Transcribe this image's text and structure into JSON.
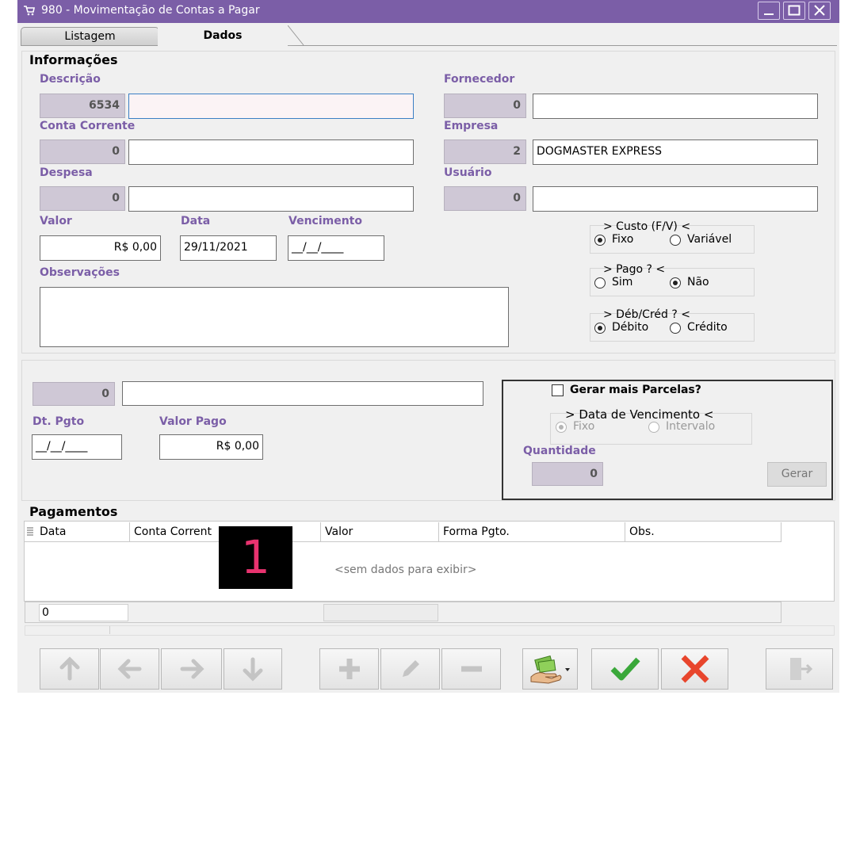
{
  "window": {
    "title": "980 - Movimentação de Contas a Pagar",
    "title_color": "#7b5ea7"
  },
  "tabs": [
    {
      "label": "Listagem",
      "active": false
    },
    {
      "label": "Dados",
      "active": true
    }
  ],
  "informacoes": {
    "section_title": "Informações",
    "descricao": {
      "label": "Descrição",
      "code": "6534",
      "value": ""
    },
    "conta_corrente": {
      "label": "Conta Corrente",
      "code": "0",
      "value": ""
    },
    "despesa": {
      "label": "Despesa",
      "code": "0",
      "value": ""
    },
    "fornecedor": {
      "label": "Fornecedor",
      "code": "0",
      "value": ""
    },
    "empresa": {
      "label": "Empresa",
      "code": "2",
      "value": "DOGMASTER EXPRESS"
    },
    "usuario": {
      "label": "Usuário",
      "code": "0",
      "value": ""
    },
    "valor": {
      "label": "Valor",
      "value": "R$ 0,00"
    },
    "data": {
      "label": "Data",
      "value": "29/11/2021"
    },
    "vencimento": {
      "label": "Vencimento",
      "value": "__/__/____"
    },
    "observacoes": {
      "label": "Observações",
      "value": ""
    },
    "custo": {
      "title": "> Custo (F/V) <",
      "options": [
        "Fixo",
        "Variável"
      ],
      "selected": "Fixo"
    },
    "pago": {
      "title": "> Pago ? <",
      "options": [
        "Sim",
        "Não"
      ],
      "selected": "Não"
    },
    "debcred": {
      "title": "> Déb/Créd ? <",
      "options": [
        "Débito",
        "Crédito"
      ],
      "selected": "Débito"
    }
  },
  "pagamento_form": {
    "code": "0",
    "value": "",
    "dt_pgto": {
      "label": "Dt. Pgto",
      "value": "__/__/____"
    },
    "valor_pago": {
      "label": "Valor Pago",
      "value": "R$ 0,00"
    }
  },
  "parcelas": {
    "checkbox_label": "Gerar mais Parcelas?",
    "checked": false,
    "vencimento_title": "> Data de Vencimento <",
    "options": [
      "Fixo",
      "Intervalo"
    ],
    "selected": "Fixo",
    "quantidade_label": "Quantidade",
    "quantidade": "0",
    "gerar_label": "Gerar"
  },
  "pagamentos": {
    "section_title": "Pagamentos",
    "columns": [
      "Data",
      "Conta Corrent",
      "Valor",
      "Forma Pgto.",
      "Obs."
    ],
    "empty_text": "<sem dados para exibir>",
    "footer_count": "0"
  },
  "overlay_badge": {
    "text": "1",
    "color": "#e8336f"
  },
  "toolbar": {
    "buttons": [
      "arrow-up-icon",
      "arrow-left-icon",
      "arrow-right-icon",
      "arrow-down-icon",
      "plus-icon",
      "pencil-icon",
      "minus-icon",
      "money-hand-icon",
      "check-icon",
      "cross-icon",
      "exit-door-icon"
    ],
    "confirm_color": "#3aa83a",
    "cancel_color": "#e8452c"
  }
}
